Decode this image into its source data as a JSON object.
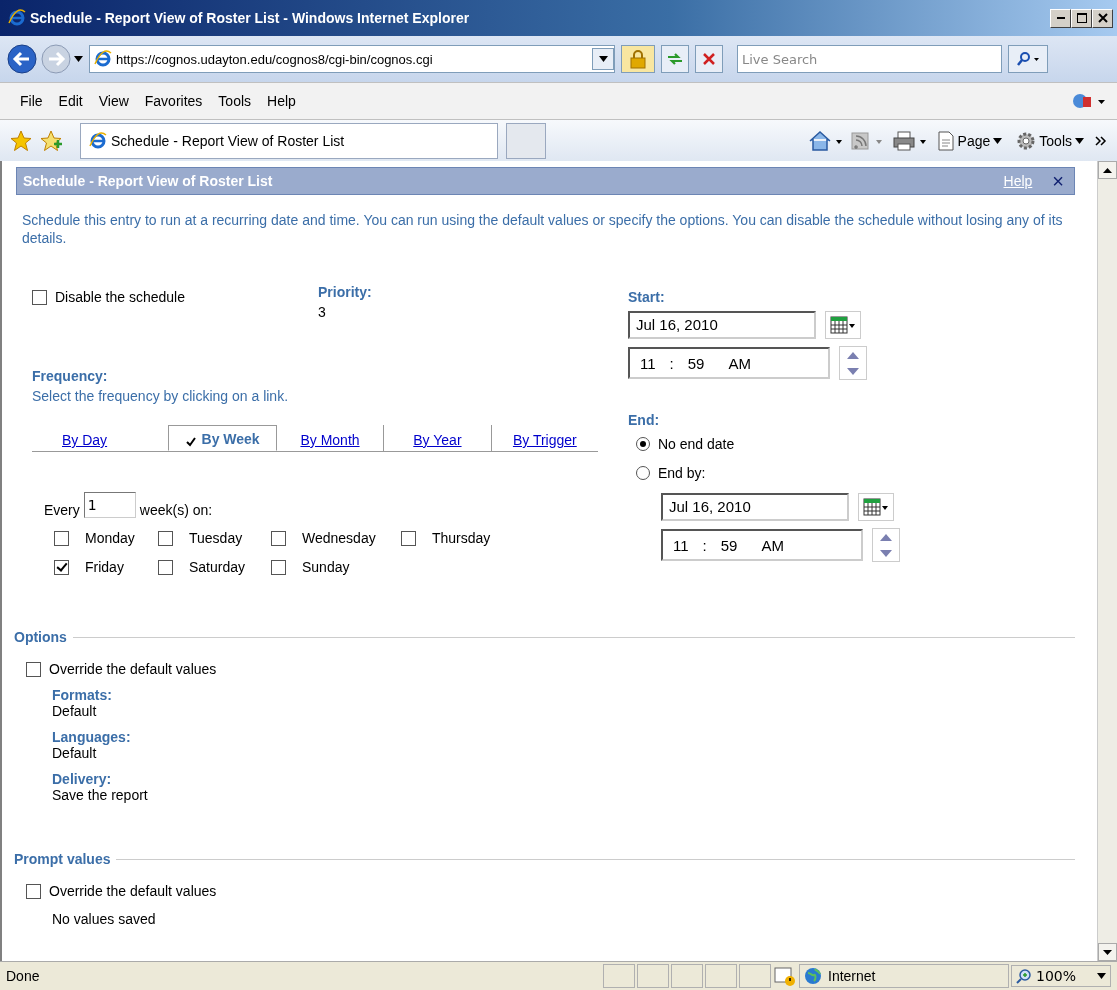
{
  "window": {
    "title": "Schedule - Report View of Roster List - Windows Internet Explorer"
  },
  "address_bar": {
    "url": "https://cognos.udayton.edu/cognos8/cgi-bin/cognos.cgi",
    "search_placeholder": "Live Search"
  },
  "menu": [
    "File",
    "Edit",
    "View",
    "Favorites",
    "Tools",
    "Help"
  ],
  "browser_tabs": [
    {
      "label": "Schedule - Report View of Roster List",
      "selected": true
    }
  ],
  "command_bar": [
    "Page",
    "Tools"
  ],
  "panel": {
    "title": "Schedule - Report View of Roster List",
    "help": "Help",
    "close": "×",
    "description": "Schedule this entry to run at a recurring date and time. You can run using the default values or specify the options. You can disable the schedule without losing any of its details."
  },
  "disable": {
    "label": "Disable the schedule",
    "checked": false
  },
  "priority": {
    "label": "Priority:",
    "value": "3"
  },
  "frequency": {
    "label": "Frequency:",
    "hint": "Select the frequency by clicking on a link.",
    "tabs": [
      {
        "label": "By Day",
        "selected": false
      },
      {
        "label": "By Week",
        "selected": true
      },
      {
        "label": "By Month",
        "selected": false
      },
      {
        "label": "By Year",
        "selected": false
      },
      {
        "label": "By Trigger",
        "selected": false
      }
    ],
    "every_label": "Every",
    "every_value": "1",
    "unit": "week(s) on:",
    "days": [
      {
        "label": "Monday",
        "checked": false
      },
      {
        "label": "Tuesday",
        "checked": false
      },
      {
        "label": "Wednesday",
        "checked": false
      },
      {
        "label": "Thursday",
        "checked": false
      },
      {
        "label": "Friday",
        "checked": true
      },
      {
        "label": "Saturday",
        "checked": false
      },
      {
        "label": "Sunday",
        "checked": false
      }
    ]
  },
  "start": {
    "label": "Start:",
    "date": "Jul 16, 2010",
    "hour": "11",
    "separator": ":",
    "minute": "59",
    "ampm": "AM"
  },
  "end": {
    "label": "End:",
    "options": [
      {
        "label": "No end date",
        "selected": true
      },
      {
        "label": "End by:",
        "selected": false
      }
    ],
    "date": "Jul 16, 2010",
    "hour": "11",
    "separator": ":",
    "minute": "59",
    "ampm": "AM"
  },
  "options": {
    "title": "Options",
    "override": {
      "label": "Override the default values",
      "checked": false
    },
    "fields": [
      {
        "label": "Formats:",
        "value": "Default"
      },
      {
        "label": "Languages:",
        "value": "Default"
      },
      {
        "label": "Delivery:",
        "value": "Save the report"
      }
    ]
  },
  "prompt_values": {
    "title": "Prompt values",
    "override": {
      "label": "Override the default values",
      "checked": false
    },
    "note": "No values saved"
  },
  "status_bar": {
    "text": "Done",
    "zone": "Internet",
    "zoom": "100%"
  }
}
